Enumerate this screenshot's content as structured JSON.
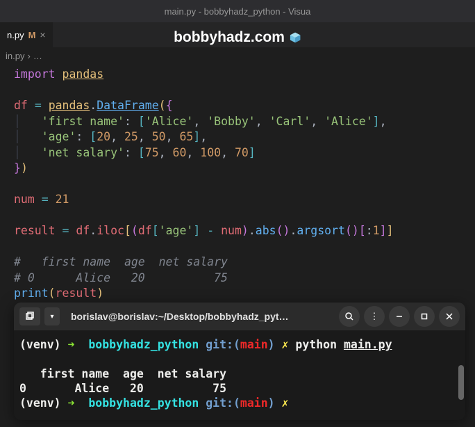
{
  "titlebar": "main.py - bobbyhadz_python - Visua",
  "tab": {
    "name": "n.py",
    "modified": "M",
    "close": "×"
  },
  "watermark": "bobbyhadz.com",
  "breadcrumb": {
    "file": "in.py",
    "sep": "›",
    "dots": "…"
  },
  "code": {
    "l1": {
      "import": "import",
      "pandas": "pandas"
    },
    "l3": {
      "df": "df",
      "eq": "=",
      "pandas": "pandas",
      "dot": ".",
      "DataFrame": "DataFrame",
      "open": "(",
      "brace": "{"
    },
    "l4": {
      "key": "'first name'",
      "colon": ":",
      "open": "[",
      "v1": "'Alice'",
      "c": ",",
      "v2": "'Bobby'",
      "v3": "'Carl'",
      "v4": "'Alice'",
      "close": "]"
    },
    "l5": {
      "key": "'age'",
      "colon": ":",
      "open": "[",
      "v1": "20",
      "c": ",",
      "v2": "25",
      "v3": "50",
      "v4": "65",
      "close": "]"
    },
    "l6": {
      "key": "'net salary'",
      "colon": ":",
      "open": "[",
      "v1": "75",
      "c": ",",
      "v2": "60",
      "v3": "100",
      "v4": "70",
      "close": "]"
    },
    "l7": {
      "brace": "}",
      "paren": ")"
    },
    "l9": {
      "num_var": "num",
      "eq": "=",
      "val": "21"
    },
    "l11": {
      "result": "result",
      "eq": "=",
      "df": "df",
      "dot": ".",
      "iloc": "iloc",
      "o1": "[",
      "o2": "(",
      "df2": "df",
      "o3": "[",
      "age": "'age'",
      "c3": "]",
      "minus": "-",
      "numv": "num",
      "c2": ")",
      "dot2": ".",
      "abs": "abs",
      "p1": "(",
      "p2": ")",
      "dot3": ".",
      "argsort": "argsort",
      "p3": "(",
      "p4": ")",
      "o4": "[",
      "colon": ":",
      "one": "1",
      "c4": "]",
      "c1": "]"
    },
    "l13": "#   first name  age  net salary",
    "l14": "# 0      Alice   20          75",
    "l15": {
      "print": "print",
      "o": "(",
      "result": "result",
      "c": ")"
    }
  },
  "terminal": {
    "title": "borislav@borislav:~/Desktop/bobbyhadz_pyt…",
    "prompt": {
      "venv": "(venv)",
      "arrow": "➜",
      "dir": "bobbyhadz_python",
      "git": "git:(",
      "branch": "main",
      "gitclose": ")",
      "dirty": "✗"
    },
    "cmd": {
      "python": "python",
      "file": "main.py"
    },
    "output": {
      "header": "   first name  age  net salary",
      "row": "0       Alice   20          75"
    }
  }
}
